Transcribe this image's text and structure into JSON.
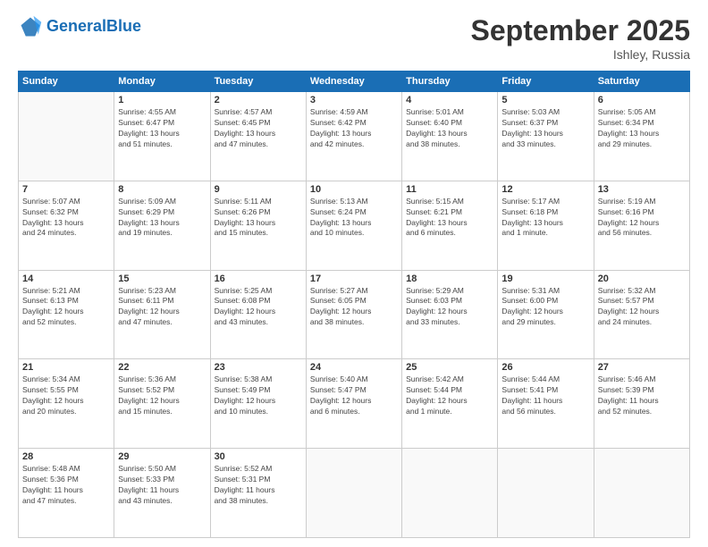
{
  "app": {
    "logo_text_general": "General",
    "logo_text_blue": "Blue"
  },
  "header": {
    "month": "September 2025",
    "location": "Ishley, Russia"
  },
  "weekdays": [
    "Sunday",
    "Monday",
    "Tuesday",
    "Wednesday",
    "Thursday",
    "Friday",
    "Saturday"
  ],
  "weeks": [
    [
      {
        "day": "",
        "info": ""
      },
      {
        "day": "1",
        "info": "Sunrise: 4:55 AM\nSunset: 6:47 PM\nDaylight: 13 hours\nand 51 minutes."
      },
      {
        "day": "2",
        "info": "Sunrise: 4:57 AM\nSunset: 6:45 PM\nDaylight: 13 hours\nand 47 minutes."
      },
      {
        "day": "3",
        "info": "Sunrise: 4:59 AM\nSunset: 6:42 PM\nDaylight: 13 hours\nand 42 minutes."
      },
      {
        "day": "4",
        "info": "Sunrise: 5:01 AM\nSunset: 6:40 PM\nDaylight: 13 hours\nand 38 minutes."
      },
      {
        "day": "5",
        "info": "Sunrise: 5:03 AM\nSunset: 6:37 PM\nDaylight: 13 hours\nand 33 minutes."
      },
      {
        "day": "6",
        "info": "Sunrise: 5:05 AM\nSunset: 6:34 PM\nDaylight: 13 hours\nand 29 minutes."
      }
    ],
    [
      {
        "day": "7",
        "info": "Sunrise: 5:07 AM\nSunset: 6:32 PM\nDaylight: 13 hours\nand 24 minutes."
      },
      {
        "day": "8",
        "info": "Sunrise: 5:09 AM\nSunset: 6:29 PM\nDaylight: 13 hours\nand 19 minutes."
      },
      {
        "day": "9",
        "info": "Sunrise: 5:11 AM\nSunset: 6:26 PM\nDaylight: 13 hours\nand 15 minutes."
      },
      {
        "day": "10",
        "info": "Sunrise: 5:13 AM\nSunset: 6:24 PM\nDaylight: 13 hours\nand 10 minutes."
      },
      {
        "day": "11",
        "info": "Sunrise: 5:15 AM\nSunset: 6:21 PM\nDaylight: 13 hours\nand 6 minutes."
      },
      {
        "day": "12",
        "info": "Sunrise: 5:17 AM\nSunset: 6:18 PM\nDaylight: 13 hours\nand 1 minute."
      },
      {
        "day": "13",
        "info": "Sunrise: 5:19 AM\nSunset: 6:16 PM\nDaylight: 12 hours\nand 56 minutes."
      }
    ],
    [
      {
        "day": "14",
        "info": "Sunrise: 5:21 AM\nSunset: 6:13 PM\nDaylight: 12 hours\nand 52 minutes."
      },
      {
        "day": "15",
        "info": "Sunrise: 5:23 AM\nSunset: 6:11 PM\nDaylight: 12 hours\nand 47 minutes."
      },
      {
        "day": "16",
        "info": "Sunrise: 5:25 AM\nSunset: 6:08 PM\nDaylight: 12 hours\nand 43 minutes."
      },
      {
        "day": "17",
        "info": "Sunrise: 5:27 AM\nSunset: 6:05 PM\nDaylight: 12 hours\nand 38 minutes."
      },
      {
        "day": "18",
        "info": "Sunrise: 5:29 AM\nSunset: 6:03 PM\nDaylight: 12 hours\nand 33 minutes."
      },
      {
        "day": "19",
        "info": "Sunrise: 5:31 AM\nSunset: 6:00 PM\nDaylight: 12 hours\nand 29 minutes."
      },
      {
        "day": "20",
        "info": "Sunrise: 5:32 AM\nSunset: 5:57 PM\nDaylight: 12 hours\nand 24 minutes."
      }
    ],
    [
      {
        "day": "21",
        "info": "Sunrise: 5:34 AM\nSunset: 5:55 PM\nDaylight: 12 hours\nand 20 minutes."
      },
      {
        "day": "22",
        "info": "Sunrise: 5:36 AM\nSunset: 5:52 PM\nDaylight: 12 hours\nand 15 minutes."
      },
      {
        "day": "23",
        "info": "Sunrise: 5:38 AM\nSunset: 5:49 PM\nDaylight: 12 hours\nand 10 minutes."
      },
      {
        "day": "24",
        "info": "Sunrise: 5:40 AM\nSunset: 5:47 PM\nDaylight: 12 hours\nand 6 minutes."
      },
      {
        "day": "25",
        "info": "Sunrise: 5:42 AM\nSunset: 5:44 PM\nDaylight: 12 hours\nand 1 minute."
      },
      {
        "day": "26",
        "info": "Sunrise: 5:44 AM\nSunset: 5:41 PM\nDaylight: 11 hours\nand 56 minutes."
      },
      {
        "day": "27",
        "info": "Sunrise: 5:46 AM\nSunset: 5:39 PM\nDaylight: 11 hours\nand 52 minutes."
      }
    ],
    [
      {
        "day": "28",
        "info": "Sunrise: 5:48 AM\nSunset: 5:36 PM\nDaylight: 11 hours\nand 47 minutes."
      },
      {
        "day": "29",
        "info": "Sunrise: 5:50 AM\nSunset: 5:33 PM\nDaylight: 11 hours\nand 43 minutes."
      },
      {
        "day": "30",
        "info": "Sunrise: 5:52 AM\nSunset: 5:31 PM\nDaylight: 11 hours\nand 38 minutes."
      },
      {
        "day": "",
        "info": ""
      },
      {
        "day": "",
        "info": ""
      },
      {
        "day": "",
        "info": ""
      },
      {
        "day": "",
        "info": ""
      }
    ]
  ]
}
